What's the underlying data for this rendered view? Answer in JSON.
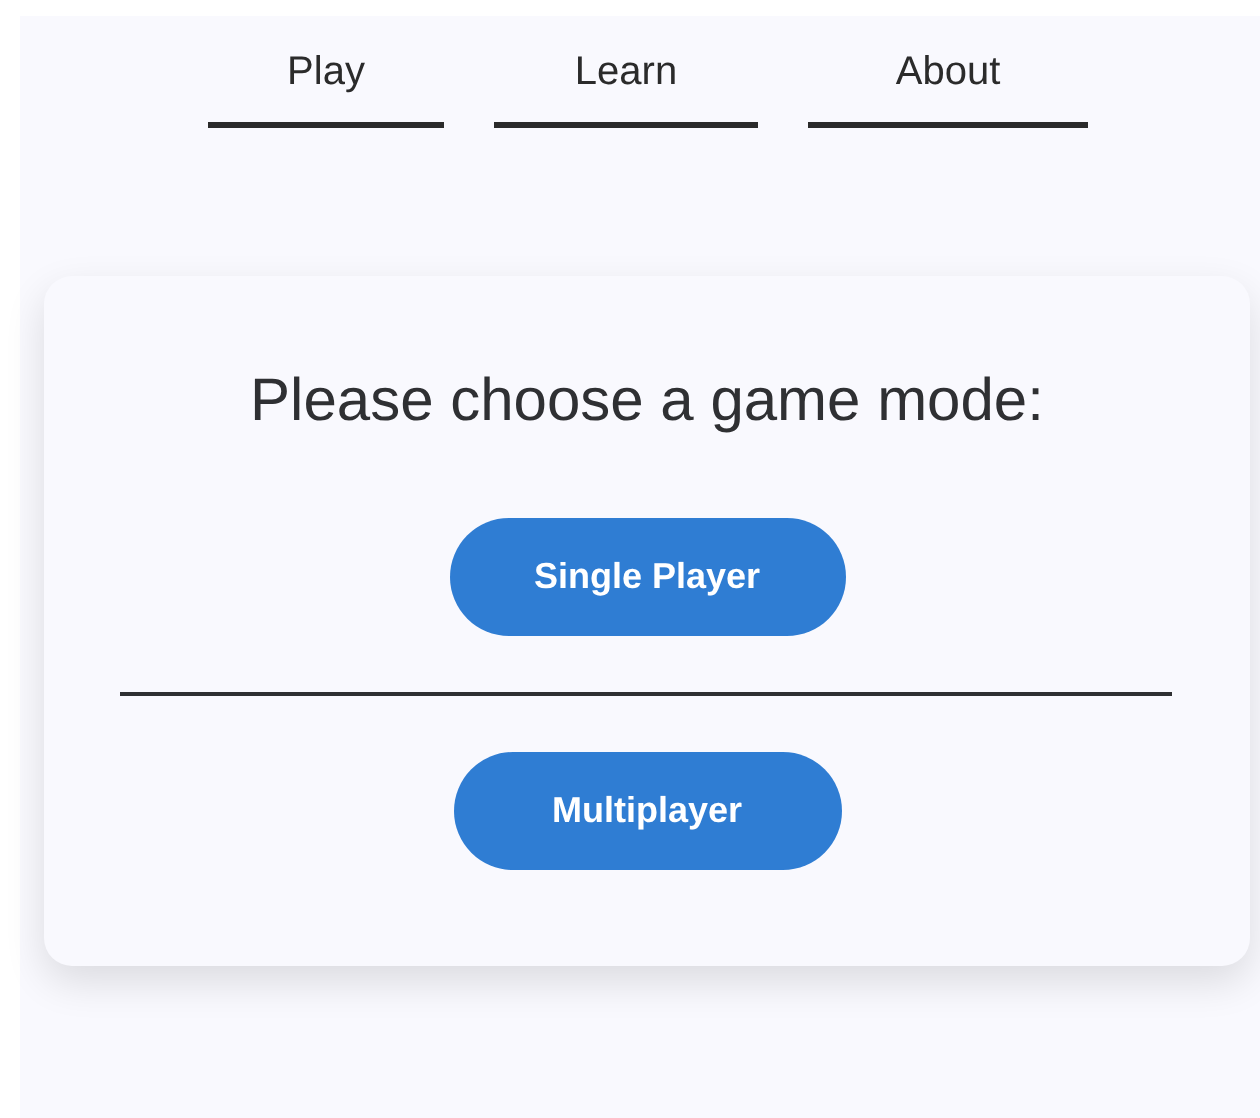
{
  "nav": [
    {
      "label": "Play"
    },
    {
      "label": "Learn"
    },
    {
      "label": "About"
    }
  ],
  "card": {
    "title": "Please choose a game mode:",
    "buttons": [
      {
        "label": "Single Player"
      },
      {
        "label": "Multiplayer"
      }
    ]
  }
}
